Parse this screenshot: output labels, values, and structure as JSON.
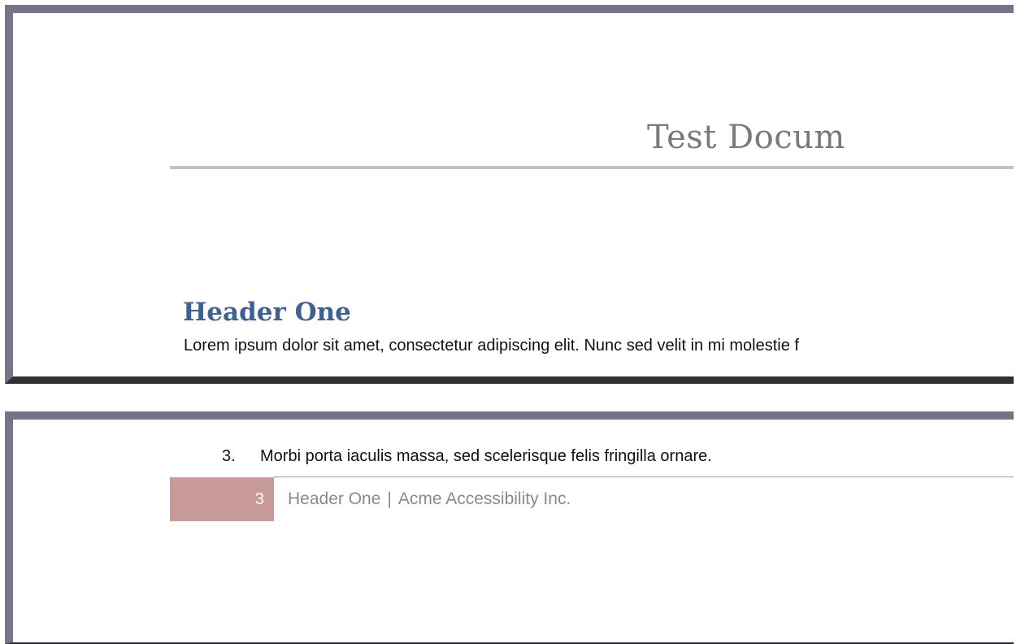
{
  "document": {
    "title": "Test Docum",
    "heading": "Header One",
    "paragraph": "Lorem ipsum dolor sit amet, consectetur adipiscing elit. Nunc sed velit in mi molestie f"
  },
  "list": {
    "item_number": "3.",
    "item_text": "Morbi porta iaculis massa, sed scelerisque felis fringilla ornare."
  },
  "footer": {
    "page_number": "3",
    "section": "Header One",
    "separator": "|",
    "company": "Acme Accessibility Inc."
  },
  "colors": {
    "heading": "#3f6190",
    "page_number_box": "#c99a9a",
    "frame": "#767486"
  }
}
